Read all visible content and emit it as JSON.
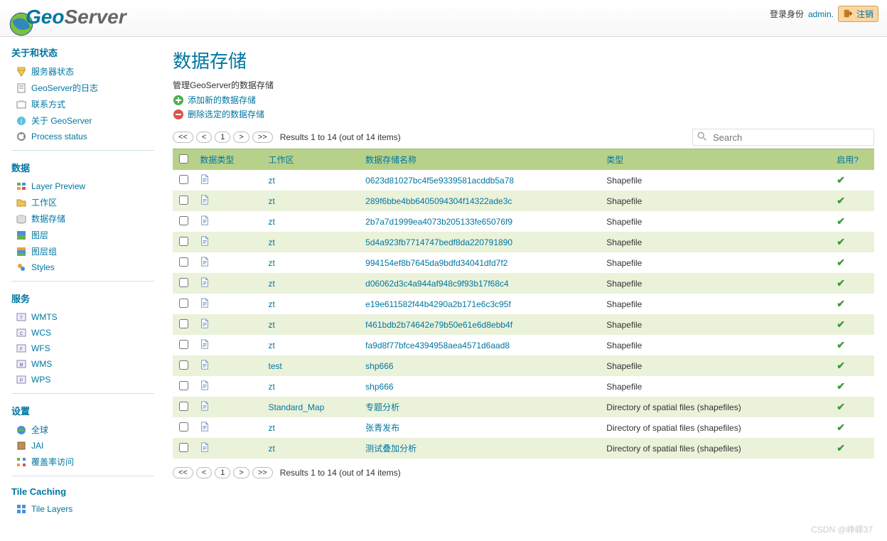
{
  "header": {
    "brand_geo": "Geo",
    "brand_server": "Server",
    "login_prefix": "登录身份",
    "login_user": "admin.",
    "logout": "注销"
  },
  "sidebar": {
    "sections": [
      {
        "title": "关于和状态",
        "items": [
          "服务器状态",
          "GeoServer的日志",
          "联系方式",
          "关于 GeoServer",
          "Process status"
        ]
      },
      {
        "title": "数据",
        "items": [
          "Layer Preview",
          "工作区",
          "数据存储",
          "图层",
          "图层组",
          "Styles"
        ]
      },
      {
        "title": "服务",
        "items": [
          "WMTS",
          "WCS",
          "WFS",
          "WMS",
          "WPS"
        ]
      },
      {
        "title": "设置",
        "items": [
          "全球",
          "JAI",
          "覆盖率访问"
        ]
      },
      {
        "title": "Tile Caching",
        "items": [
          "Tile Layers"
        ]
      }
    ]
  },
  "page": {
    "title": "数据存储",
    "subtitle": "管理GeoServer的数据存储",
    "add_link": "添加新的数据存储",
    "remove_link": "删除选定的数据存储",
    "results_text": "Results 1 to 14 (out of 14 items)",
    "search_placeholder": "Search",
    "pager": {
      "first": "<<",
      "prev": "<",
      "page": "1",
      "next": ">",
      "last": ">>"
    }
  },
  "table": {
    "headers": [
      "数据类型",
      "工作区",
      "数据存储名称",
      "类型",
      "启用?"
    ],
    "rows": [
      {
        "ws": "zt",
        "name": "0623d81027bc4f5e9339581acddb5a78",
        "kind": "Shapefile",
        "enabled": true
      },
      {
        "ws": "zt",
        "name": "289f6bbe4bb6405094304f14322ade3c",
        "kind": "Shapefile",
        "enabled": true
      },
      {
        "ws": "zt",
        "name": "2b7a7d1999ea4073b205133fe65076f9",
        "kind": "Shapefile",
        "enabled": true
      },
      {
        "ws": "zt",
        "name": "5d4a923fb7714747bedf8da220791890",
        "kind": "Shapefile",
        "enabled": true
      },
      {
        "ws": "zt",
        "name": "994154ef8b7645da9bdfd34041dfd7f2",
        "kind": "Shapefile",
        "enabled": true
      },
      {
        "ws": "zt",
        "name": "d06062d3c4a944af948c9f93b17f68c4",
        "kind": "Shapefile",
        "enabled": true
      },
      {
        "ws": "zt",
        "name": "e19e611582f44b4290a2b171e6c3c95f",
        "kind": "Shapefile",
        "enabled": true
      },
      {
        "ws": "zt",
        "name": "f461bdb2b74642e79b50e61e6d8ebb4f",
        "kind": "Shapefile",
        "enabled": true
      },
      {
        "ws": "zt",
        "name": "fa9d8f77bfce4394958aea4571d6aad8",
        "kind": "Shapefile",
        "enabled": true
      },
      {
        "ws": "test",
        "name": "shp666",
        "kind": "Shapefile",
        "enabled": true
      },
      {
        "ws": "zt",
        "name": "shp666",
        "kind": "Shapefile",
        "enabled": true
      },
      {
        "ws": "Standard_Map",
        "name": "专题分析",
        "kind": "Directory of spatial files (shapefiles)",
        "enabled": true
      },
      {
        "ws": "zt",
        "name": "张青发布",
        "kind": "Directory of spatial files (shapefiles)",
        "enabled": true
      },
      {
        "ws": "zt",
        "name": "测试叠加分析",
        "kind": "Directory of spatial files (shapefiles)",
        "enabled": true
      }
    ]
  },
  "watermark": "CSDN @峥嵘37"
}
